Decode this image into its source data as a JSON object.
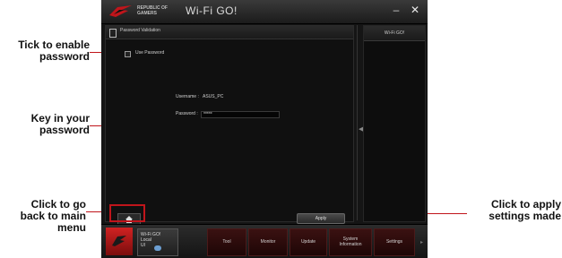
{
  "callouts": {
    "enable_password": "Tick to enable\npassword",
    "key_password": "Key in your\npassword",
    "back_main": "Click to go\nback to main\nmenu",
    "apply_settings": "Click to apply\nsettings made"
  },
  "titlebar": {
    "logo_text": "REPUBLIC OF GAMERS",
    "app_title": "Wi-Fi GO!",
    "minimize": "–",
    "close": "✕"
  },
  "panel": {
    "header": "Password Validation",
    "checkbox_label": "Use Password",
    "checkbox_checked": false,
    "username_label": "Username :",
    "username_value": "ASUS_PC",
    "password_label": "Password :",
    "password_value": "*****",
    "apply_label": "Apply"
  },
  "side": {
    "tab_label": "Wi-Fi GO!"
  },
  "bottom_tabs": [
    {
      "label": "Wi-Fi GO!\nLocal\nUI"
    },
    {
      "label": "Tool"
    },
    {
      "label": "Monitor"
    },
    {
      "label": "Update"
    },
    {
      "label": "System\nInformation"
    },
    {
      "label": "Settings"
    }
  ],
  "colors": {
    "accent_red": "#c0151b",
    "app_bg": "#151515"
  }
}
